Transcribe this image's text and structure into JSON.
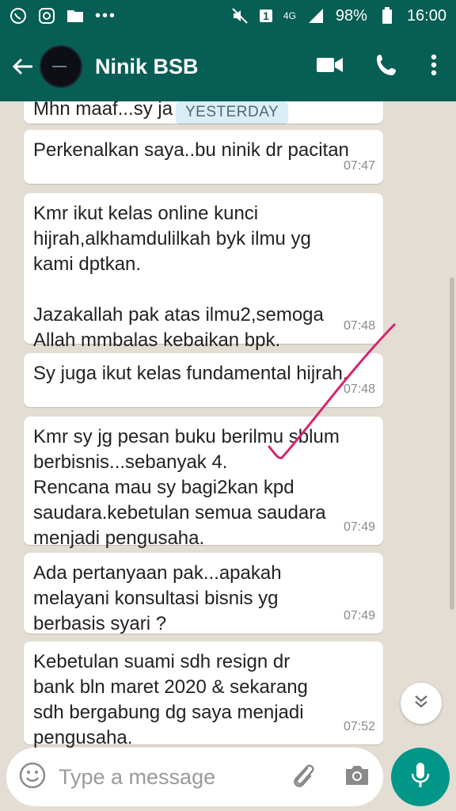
{
  "status_bar": {
    "battery": "98%",
    "time": "16:00",
    "network": "4G",
    "sim": "1",
    "more": "•••"
  },
  "header": {
    "contact_name": "Ninik BSB"
  },
  "chat": {
    "date_chip": "YESTERDAY",
    "partial_message": "Mhn maaf...sy ja",
    "messages": [
      {
        "text": "Perkenalkan saya..bu ninik dr pacitan",
        "time": "07:47"
      },
      {
        "text": "Kmr ikut kelas online kunci\nhijrah,alkhamdulilkah byk ilmu yg\nkami dptkan.\n\nJazakallah pak atas ilmu2,semoga\nAllah mmbalas kebaikan bpk.",
        "time": "07:48"
      },
      {
        "text": "Sy juga ikut kelas fundamental hijrah.",
        "time": "07:48"
      },
      {
        "text": "Kmr sy jg pesan buku berilmu sblum\nberbisnis...sebanyak 4.\nRencana mau sy bagi2kan kpd\nsaudara.kebetulan semua saudara\nmenjadi pengusaha.",
        "time": "07:49"
      },
      {
        "text": "Ada pertanyaan pak...apakah\nmelayani konsultasi bisnis yg\nberbasis syari ?",
        "time": "07:49"
      },
      {
        "text": "Kebetulan suami sdh resign dr\nbank bln maret 2020 & sekarang\nsdh bergabung dg saya menjadi\npengusaha.",
        "time": "07:52"
      }
    ]
  },
  "composer": {
    "placeholder": "Type a message"
  },
  "colors": {
    "header": "#075e54",
    "chat_background": "#e4ddd4",
    "mic_button": "#009688",
    "annotation": "#d6246e"
  },
  "icons": [
    "whatsapp-icon",
    "instagram-icon",
    "folder-icon",
    "mute-icon",
    "signal-icon",
    "battery-icon",
    "back-arrow-icon",
    "video-call-icon",
    "phone-call-icon",
    "more-vert-icon",
    "emoji-icon",
    "attach-icon",
    "camera-icon",
    "mic-icon",
    "chevron-double-down-icon"
  ]
}
